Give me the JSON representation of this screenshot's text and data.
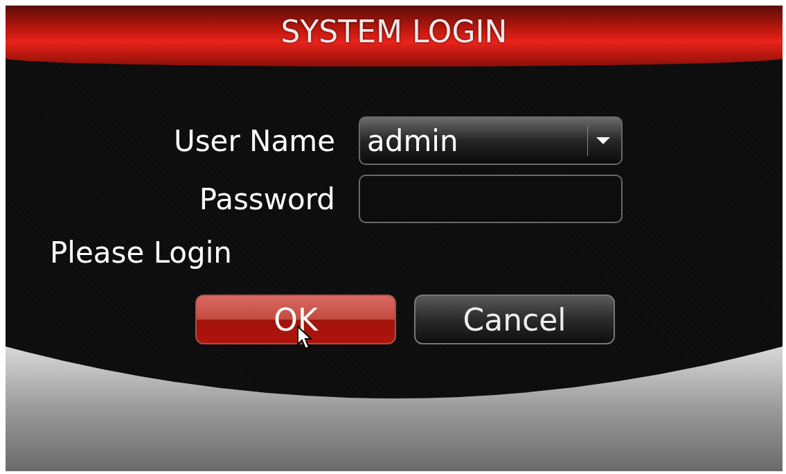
{
  "window": {
    "title": "SYSTEM LOGIN"
  },
  "fields": [
    {
      "kind": "dropdown",
      "label": "User Name",
      "value": "admin"
    },
    {
      "kind": "password",
      "label": "Password"
    }
  ],
  "status": "Please Login",
  "buttons": [
    {
      "label": "OK",
      "selected": true
    },
    {
      "label": "Cancel",
      "selected": false
    }
  ]
}
